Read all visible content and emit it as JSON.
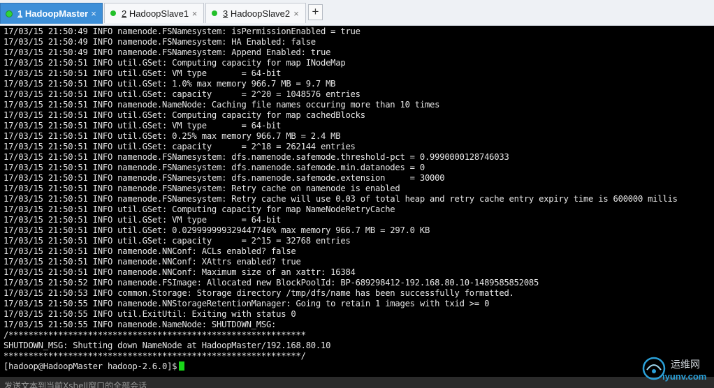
{
  "tabs": [
    {
      "number": "1",
      "name": "HadoopMaster",
      "active": true
    },
    {
      "number": "2",
      "name": "HadoopSlave1",
      "active": false
    },
    {
      "number": "3",
      "name": "HadoopSlave2",
      "active": false
    }
  ],
  "close_glyph": "×",
  "new_tab_glyph": "+",
  "terminal": {
    "lines": [
      "17/03/15 21:50:49 INFO namenode.FSNamesystem: isPermissionEnabled = true",
      "17/03/15 21:50:49 INFO namenode.FSNamesystem: HA Enabled: false",
      "17/03/15 21:50:49 INFO namenode.FSNamesystem: Append Enabled: true",
      "17/03/15 21:50:51 INFO util.GSet: Computing capacity for map INodeMap",
      "17/03/15 21:50:51 INFO util.GSet: VM type       = 64-bit",
      "17/03/15 21:50:51 INFO util.GSet: 1.0% max memory 966.7 MB = 9.7 MB",
      "17/03/15 21:50:51 INFO util.GSet: capacity      = 2^20 = 1048576 entries",
      "17/03/15 21:50:51 INFO namenode.NameNode: Caching file names occuring more than 10 times",
      "17/03/15 21:50:51 INFO util.GSet: Computing capacity for map cachedBlocks",
      "17/03/15 21:50:51 INFO util.GSet: VM type       = 64-bit",
      "17/03/15 21:50:51 INFO util.GSet: 0.25% max memory 966.7 MB = 2.4 MB",
      "17/03/15 21:50:51 INFO util.GSet: capacity      = 2^18 = 262144 entries",
      "17/03/15 21:50:51 INFO namenode.FSNamesystem: dfs.namenode.safemode.threshold-pct = 0.9990000128746033",
      "17/03/15 21:50:51 INFO namenode.FSNamesystem: dfs.namenode.safemode.min.datanodes = 0",
      "17/03/15 21:50:51 INFO namenode.FSNamesystem: dfs.namenode.safemode.extension     = 30000",
      "17/03/15 21:50:51 INFO namenode.FSNamesystem: Retry cache on namenode is enabled",
      "17/03/15 21:50:51 INFO namenode.FSNamesystem: Retry cache will use 0.03 of total heap and retry cache entry expiry time is 600000 millis",
      "17/03/15 21:50:51 INFO util.GSet: Computing capacity for map NameNodeRetryCache",
      "17/03/15 21:50:51 INFO util.GSet: VM type       = 64-bit",
      "17/03/15 21:50:51 INFO util.GSet: 0.029999999329447746% max memory 966.7 MB = 297.0 KB",
      "17/03/15 21:50:51 INFO util.GSet: capacity      = 2^15 = 32768 entries",
      "17/03/15 21:50:51 INFO namenode.NNConf: ACLs enabled? false",
      "17/03/15 21:50:51 INFO namenode.NNConf: XAttrs enabled? true",
      "17/03/15 21:50:51 INFO namenode.NNConf: Maximum size of an xattr: 16384",
      "17/03/15 21:50:52 INFO namenode.FSImage: Allocated new BlockPoolId: BP-689298412-192.168.80.10-1489585852085",
      "17/03/15 21:50:53 INFO common.Storage: Storage directory /tmp/dfs/name has been successfully formatted.",
      "17/03/15 21:50:55 INFO namenode.NNStorageRetentionManager: Going to retain 1 images with txid >= 0",
      "17/03/15 21:50:55 INFO util.ExitUtil: Exiting with status 0",
      "17/03/15 21:50:55 INFO namenode.NameNode: SHUTDOWN_MSG:",
      "/************************************************************",
      "SHUTDOWN_MSG: Shutting down NameNode at HadoopMaster/192.168.80.10",
      "************************************************************/"
    ],
    "prompt": "[hadoop@HadoopMaster hadoop-2.6.0]$"
  },
  "status_bar": {
    "hint": "发送文本到当前Xshell窗口的全部会话"
  },
  "watermark": {
    "cn": "运维网",
    "en": "iyunv.com"
  },
  "colors": {
    "active_tab": "#3d8fd8",
    "status_dot": "#23c02a",
    "cursor": "#19d719",
    "terminal_bg": "#000000",
    "terminal_fg": "#e6e6e6"
  }
}
